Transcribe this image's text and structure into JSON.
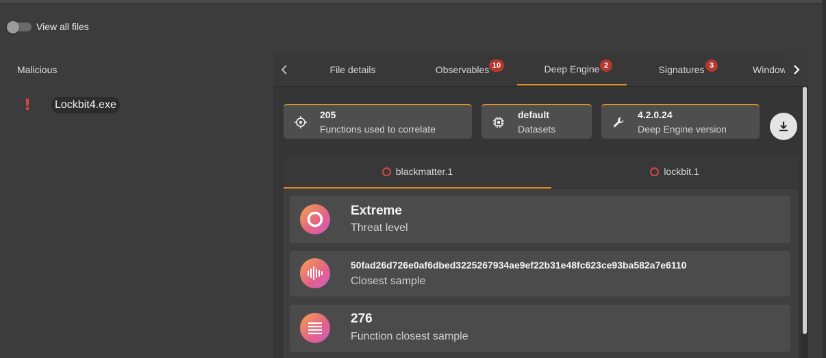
{
  "toggle": {
    "label": "View all files",
    "on": false
  },
  "section": {
    "title": "Malicious"
  },
  "files": [
    {
      "name": "Lockbit4.exe",
      "icon": "exclamation-icon"
    }
  ],
  "tabs": [
    {
      "label": "File details",
      "badge": ""
    },
    {
      "label": "Observables",
      "badge": "10"
    },
    {
      "label": "Deep Engine",
      "badge": "2",
      "active": true
    },
    {
      "label": "Signatures",
      "badge": "3"
    },
    {
      "label": "Window",
      "badge": ""
    }
  ],
  "info_cards": [
    {
      "icon": "crosshair-icon",
      "value": "205",
      "label": "Functions used to correlate"
    },
    {
      "icon": "chip-icon",
      "value": "default",
      "label": "Datasets"
    },
    {
      "icon": "wrench-icon",
      "value": "4.2.0.24",
      "label": "Deep Engine version"
    }
  ],
  "download": {
    "icon": "download-icon"
  },
  "sample_tabs": [
    {
      "label": "blackmatter.1",
      "active": true
    },
    {
      "label": "lockbit.1",
      "active": false
    }
  ],
  "results": [
    {
      "icon": "ring-icon",
      "value": "Extreme",
      "label": "Threat level"
    },
    {
      "icon": "waveform-icon",
      "value": "50fad26d726e0af6dbed3225267934ae9ef22b31e48fc623ce93ba582a7e6110",
      "label": "Closest sample"
    },
    {
      "icon": "lines-icon",
      "value": "276",
      "label": "Function closest sample"
    }
  ],
  "colors": {
    "accent": "#e0902a",
    "badge": "#b3392f",
    "danger": "#e0483f"
  }
}
